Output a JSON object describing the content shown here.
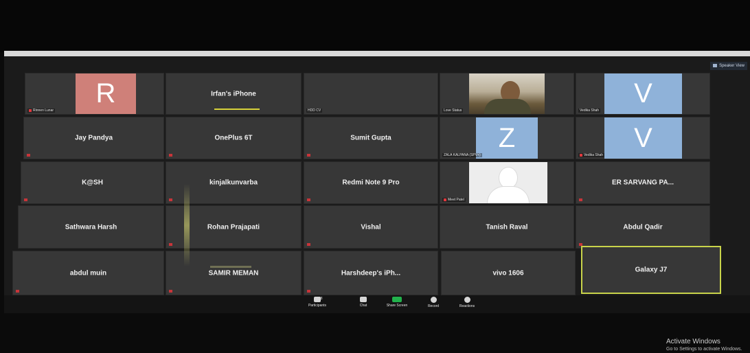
{
  "view_button": "Speaker View",
  "tiles": [
    {
      "name": "",
      "label": "Rinnen Lunar",
      "avatar": "R",
      "kind": "avatar-red"
    },
    {
      "name": "Irfan's iPhone",
      "label": "",
      "kind": "name",
      "speaking": true
    },
    {
      "name": "",
      "label": "HDD CV",
      "kind": "blank"
    },
    {
      "name": "",
      "label": "Love Status",
      "kind": "photo-person"
    },
    {
      "name": "",
      "label": "Vedika Shah",
      "avatar": "V",
      "kind": "avatar-blue"
    },
    {
      "name": "Jay Pandya",
      "label": "",
      "kind": "name"
    },
    {
      "name": "OnePlus 6T",
      "label": "",
      "kind": "name"
    },
    {
      "name": "Sumit Gupta",
      "label": "",
      "kind": "name"
    },
    {
      "name": "",
      "label": "ZALA KALPANA (SPV+)",
      "avatar": "Z",
      "kind": "avatar-blue"
    },
    {
      "name": "",
      "label": "Vedika Shah",
      "avatar": "V",
      "kind": "avatar-blue"
    },
    {
      "name": "K@SH",
      "label": "",
      "kind": "name"
    },
    {
      "name": "kinjalkunvarba",
      "label": "",
      "kind": "name"
    },
    {
      "name": "Redmi Note 9 Pro",
      "label": "",
      "kind": "name"
    },
    {
      "name": "",
      "label": "Meet Patel",
      "kind": "photo-silhouette"
    },
    {
      "name": "ER SARVANG PA...",
      "label": "",
      "kind": "name"
    },
    {
      "name": "Sathwara Harsh",
      "label": "",
      "kind": "name"
    },
    {
      "name": "Rohan Prajapati",
      "label": "",
      "kind": "name"
    },
    {
      "name": "Vishal",
      "label": "",
      "kind": "name"
    },
    {
      "name": "Tanish Raval",
      "label": "",
      "kind": "name"
    },
    {
      "name": "Abdul Qadir",
      "label": "",
      "kind": "name"
    },
    {
      "name": "abdul muin",
      "label": "",
      "kind": "name"
    },
    {
      "name": "SAMIR MEMAN",
      "label": "",
      "kind": "name"
    },
    {
      "name": "Harshdeep's iPh...",
      "label": "",
      "kind": "name"
    },
    {
      "name": "vivo 1606",
      "label": "",
      "kind": "name"
    },
    {
      "name": "Galaxy J7",
      "label": "",
      "kind": "name",
      "active": true
    }
  ],
  "toolbar": {
    "participants_label": "Participants",
    "participants_count": "28",
    "chat_label": "Chat",
    "share_label": "Share Screen",
    "record_label": "Record",
    "reactions_label": "Reactions"
  },
  "watermark": {
    "title": "Activate Windows",
    "subtitle": "Go to Settings to activate Windows."
  },
  "colors": {
    "share_green": "#22b24c",
    "active_border": "#c9d44a",
    "mute_red": "#e0393e"
  }
}
